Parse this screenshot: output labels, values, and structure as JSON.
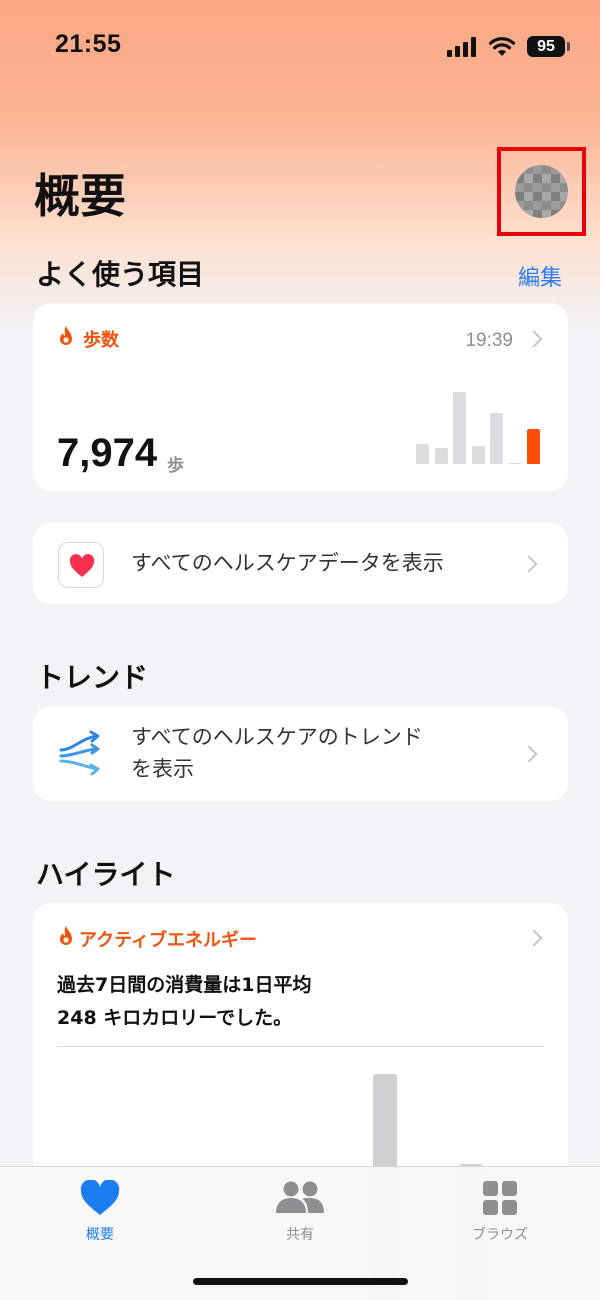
{
  "status_bar": {
    "time": "21:55",
    "battery": "95"
  },
  "header": {
    "title": "概要"
  },
  "favorites": {
    "section_title": "よく使う項目",
    "edit_label": "編集",
    "steps_card": {
      "label": "歩数",
      "time": "19:39",
      "value": "7,974",
      "unit": "歩",
      "bars": [
        0.28,
        0.22,
        1.0,
        0.25,
        0.71,
        0.0,
        0.49
      ]
    },
    "all_data_row": {
      "label": "すべてのヘルスケアデータを表示"
    }
  },
  "trends": {
    "section_title": "トレンド",
    "row_line1": "すべてのヘルスケアのトレンド",
    "row_line2": "を表示"
  },
  "highlights": {
    "section_title": "ハイライト",
    "card_label": "アクティブエネルギー",
    "text_line1": "過去7日間の消費量は1日平均",
    "text_line2": "248 キロカロリーでした。"
  },
  "tab_bar": {
    "tabs": [
      {
        "label": "概要",
        "icon": "heart-icon",
        "active": true
      },
      {
        "label": "共有",
        "icon": "people-icon",
        "active": false
      },
      {
        "label": "ブラウズ",
        "icon": "grid-icon",
        "active": false
      }
    ]
  },
  "colors": {
    "accent": "#1c7cf0",
    "orange": "#f2520c",
    "highlight_box": "#e8000b"
  }
}
